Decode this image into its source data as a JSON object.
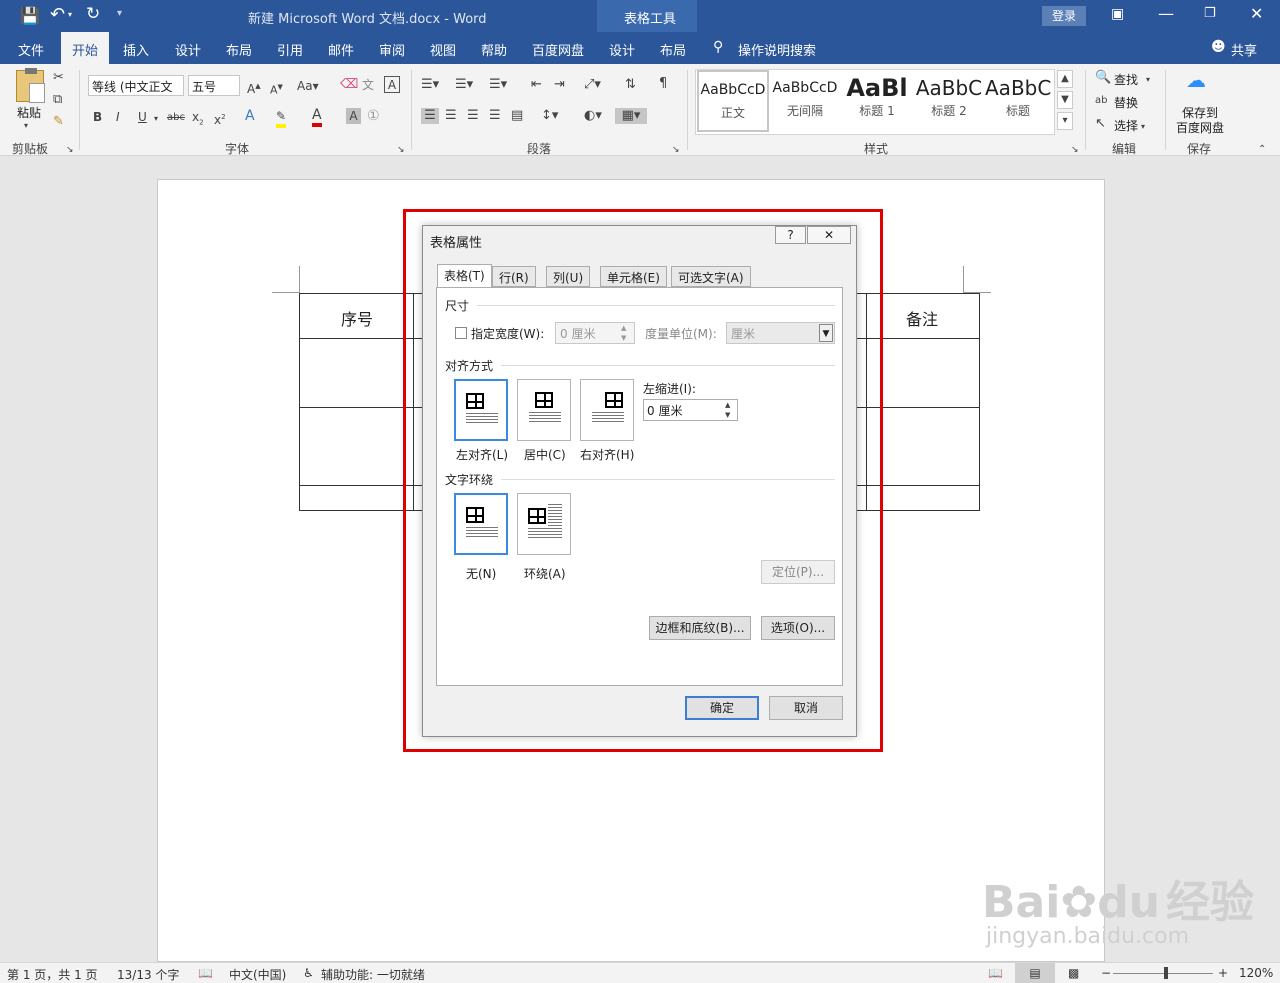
{
  "title_bar": {
    "doc_title": "新建 Microsoft Word 文档.docx  -  Word",
    "context_group": "表格工具",
    "login": "登录"
  },
  "tabs": [
    "文件",
    "开始",
    "插入",
    "设计",
    "布局",
    "引用",
    "邮件",
    "审阅",
    "视图",
    "帮助",
    "百度网盘",
    "设计",
    "布局"
  ],
  "tell_me": "操作说明搜索",
  "share": "共享",
  "ribbon": {
    "paste": "粘贴",
    "clipboard": "剪贴板",
    "font_name": "等线 (中文正文",
    "font_size": "五号",
    "font_group": "字体",
    "paragraph_group": "段落",
    "styles_group": "样式",
    "styles": [
      {
        "sample": "AaBbCcD",
        "label": "正文"
      },
      {
        "sample": "AaBbCcD",
        "label": "无间隔"
      },
      {
        "sample": "AaBl",
        "label": "标题 1"
      },
      {
        "sample": "AaBbC",
        "label": "标题 2"
      },
      {
        "sample": "AaBbC",
        "label": "标题"
      }
    ],
    "find": "查找",
    "replace": "替换",
    "select": "选择",
    "edit_group": "编辑",
    "save_baidu": "保存到",
    "save_baidu2": "百度网盘",
    "save_group": "保存"
  },
  "document": {
    "header_left": "序号",
    "header_right": "备注"
  },
  "dialog": {
    "title": "表格属性",
    "help": "?",
    "tabs": [
      "表格(T)",
      "行(R)",
      "列(U)",
      "单元格(E)",
      "可选文字(A)"
    ],
    "size_section": "尺寸",
    "preferred_width_label": "指定宽度(W):",
    "width_value": "0 厘米",
    "measure_label": "度量单位(M):",
    "measure_value": "厘米",
    "alignment_section": "对齐方式",
    "align_options": [
      "左对齐(L)",
      "居中(C)",
      "右对齐(H)"
    ],
    "indent_label": "左缩进(I):",
    "indent_value": "0 厘米",
    "wrap_section": "文字环绕",
    "wrap_options": [
      "无(N)",
      "环绕(A)"
    ],
    "position_button": "定位(P)...",
    "borders_button": "边框和底纹(B)...",
    "options_button": "选项(O)...",
    "ok_button": "确定",
    "cancel_button": "取消"
  },
  "status_bar": {
    "page": "第 1 页，共 1 页",
    "words": "13/13 个字",
    "language": "中文(中国)",
    "accessibility": "辅助功能: 一切就绪",
    "zoom": "120%"
  },
  "watermark": {
    "brand": "Bai",
    "brand2": "du",
    "product": "经验",
    "url": "jingyan.baidu.com"
  },
  "colors": {
    "word_blue": "#2b579a",
    "highlight_red": "#e00000"
  }
}
